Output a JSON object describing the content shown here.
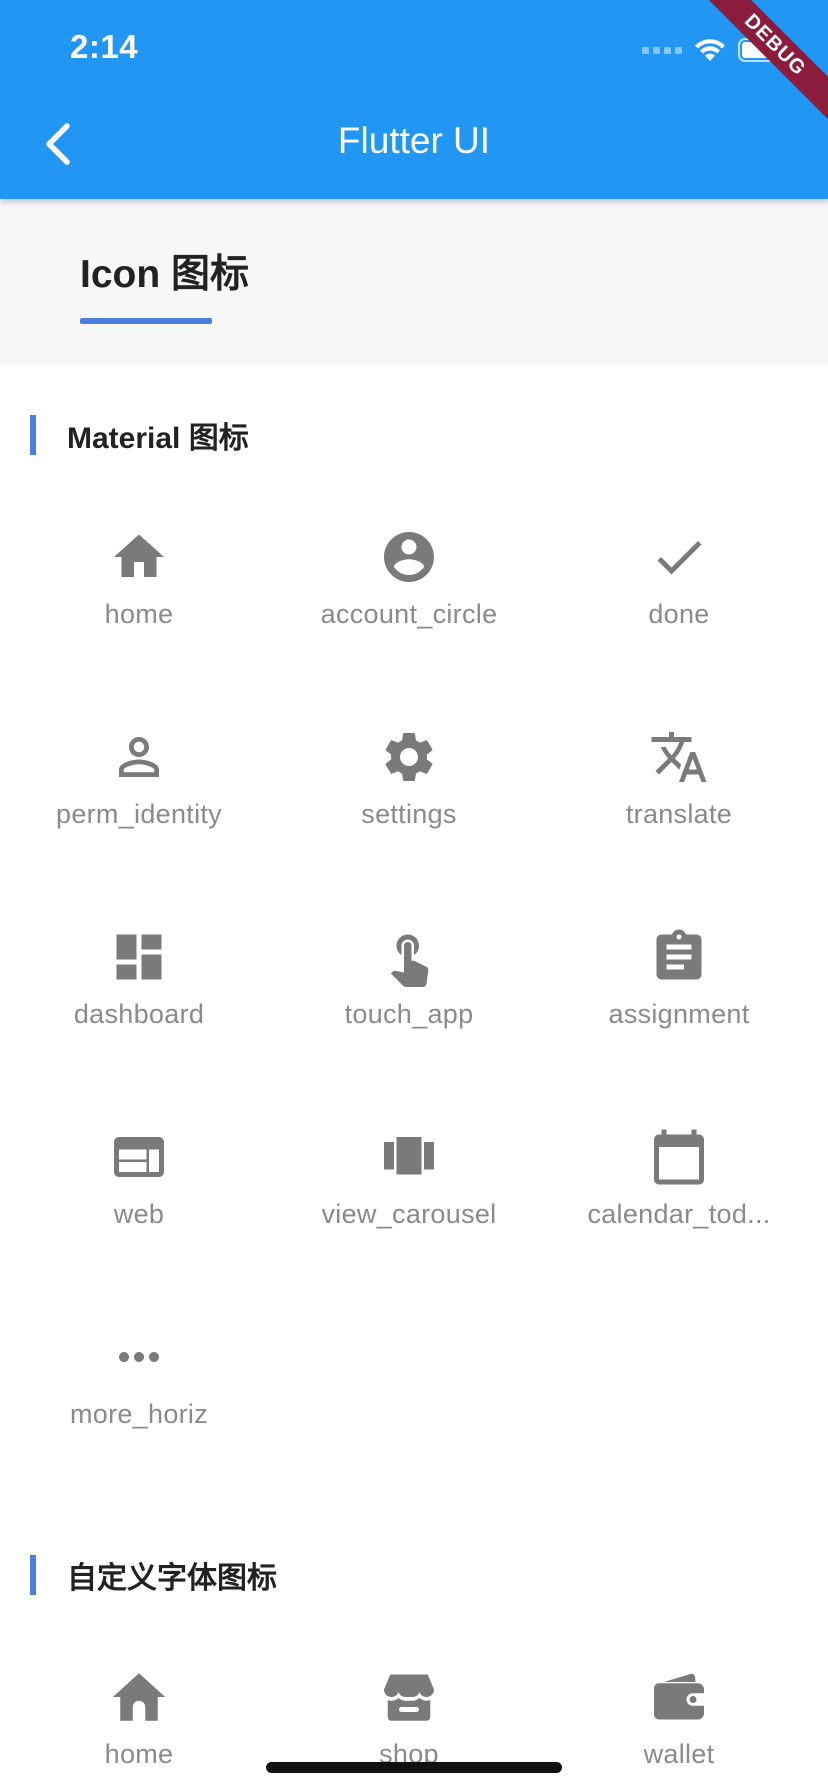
{
  "status_bar": {
    "time": "2:14"
  },
  "app_bar": {
    "title": "Flutter UI",
    "debug_banner": "DEBUG"
  },
  "tabs": [
    {
      "label": "Icon 图标",
      "selected": true
    }
  ],
  "sections": [
    {
      "title": "Material 图标",
      "icons": [
        {
          "name": "home",
          "icon": "home-icon"
        },
        {
          "name": "account_circle",
          "icon": "account-circle-icon"
        },
        {
          "name": "done",
          "icon": "check-icon"
        },
        {
          "name": "perm_identity",
          "icon": "person-outline-icon"
        },
        {
          "name": "settings",
          "icon": "gear-icon"
        },
        {
          "name": "translate",
          "icon": "translate-icon"
        },
        {
          "name": "dashboard",
          "icon": "dashboard-icon"
        },
        {
          "name": "touch_app",
          "icon": "touch-app-icon"
        },
        {
          "name": "assignment",
          "icon": "clipboard-icon"
        },
        {
          "name": "web",
          "icon": "web-icon"
        },
        {
          "name": "view_carousel",
          "icon": "carousel-icon"
        },
        {
          "name": "calendar_tod...",
          "icon": "calendar-icon"
        },
        {
          "name": "more_horiz",
          "icon": "more-horizontal-icon"
        }
      ]
    },
    {
      "title": "自定义字体图标",
      "icons": [
        {
          "name": "home",
          "icon": "home-icon"
        },
        {
          "name": "shop",
          "icon": "shop-icon"
        },
        {
          "name": "wallet",
          "icon": "wallet-icon"
        }
      ]
    }
  ],
  "colors": {
    "primary": "#2196F3",
    "accent_indicator": "#4a7fe0",
    "icon_grey": "#7a7a7a",
    "label_grey": "#8a8a8a",
    "debug_ribbon": "#8b1c3c"
  }
}
